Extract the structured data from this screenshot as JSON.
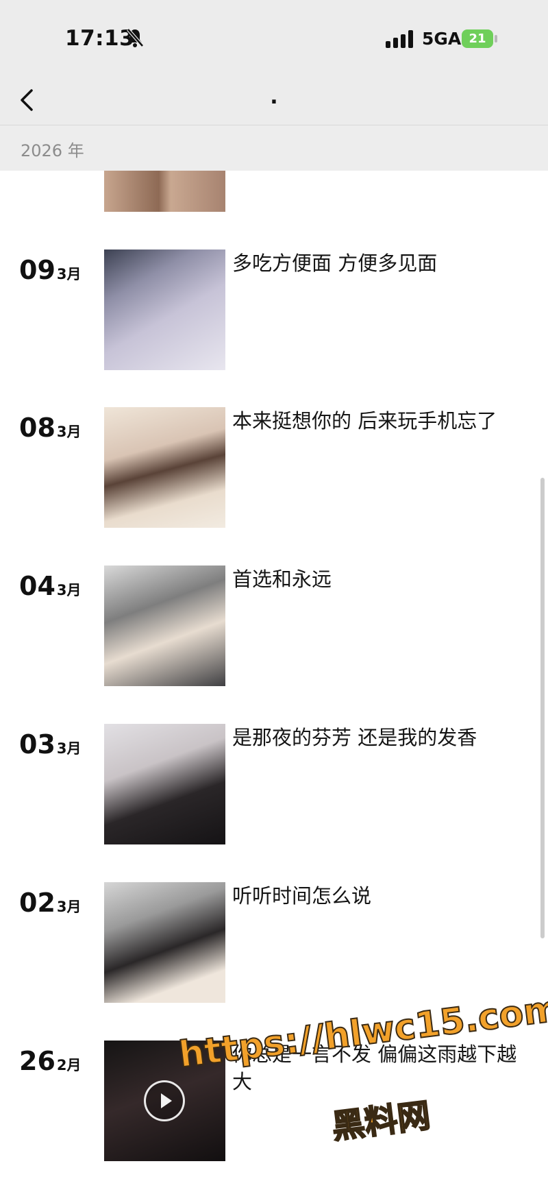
{
  "status_bar": {
    "time": "17:13",
    "network": "5GA",
    "battery": "21"
  },
  "nav": {
    "title": "."
  },
  "year_header": "2026 年",
  "entries": [
    {
      "day": "09",
      "month": "3月",
      "caption": "多吃方便面 方便多见面"
    },
    {
      "day": "08",
      "month": "3月",
      "caption": "本来挺想你的 后来玩手机忘了"
    },
    {
      "day": "04",
      "month": "3月",
      "caption": "首选和永远"
    },
    {
      "day": "03",
      "month": "3月",
      "caption": "是那夜的芬芳 还是我的发香"
    },
    {
      "day": "02",
      "month": "3月",
      "caption": "听听时间怎么说"
    },
    {
      "day": "26",
      "month": "2月",
      "caption": "你总是一言不发 偏偏这雨越下越大"
    }
  ],
  "watermark": {
    "url": "https://hlwc15.com",
    "site": "黑料网"
  },
  "colors": {
    "status_background": "#ececec",
    "year_text": "#8c8c8c",
    "battery_fill": "#6fcf5a",
    "watermark": "#f2a12a"
  }
}
